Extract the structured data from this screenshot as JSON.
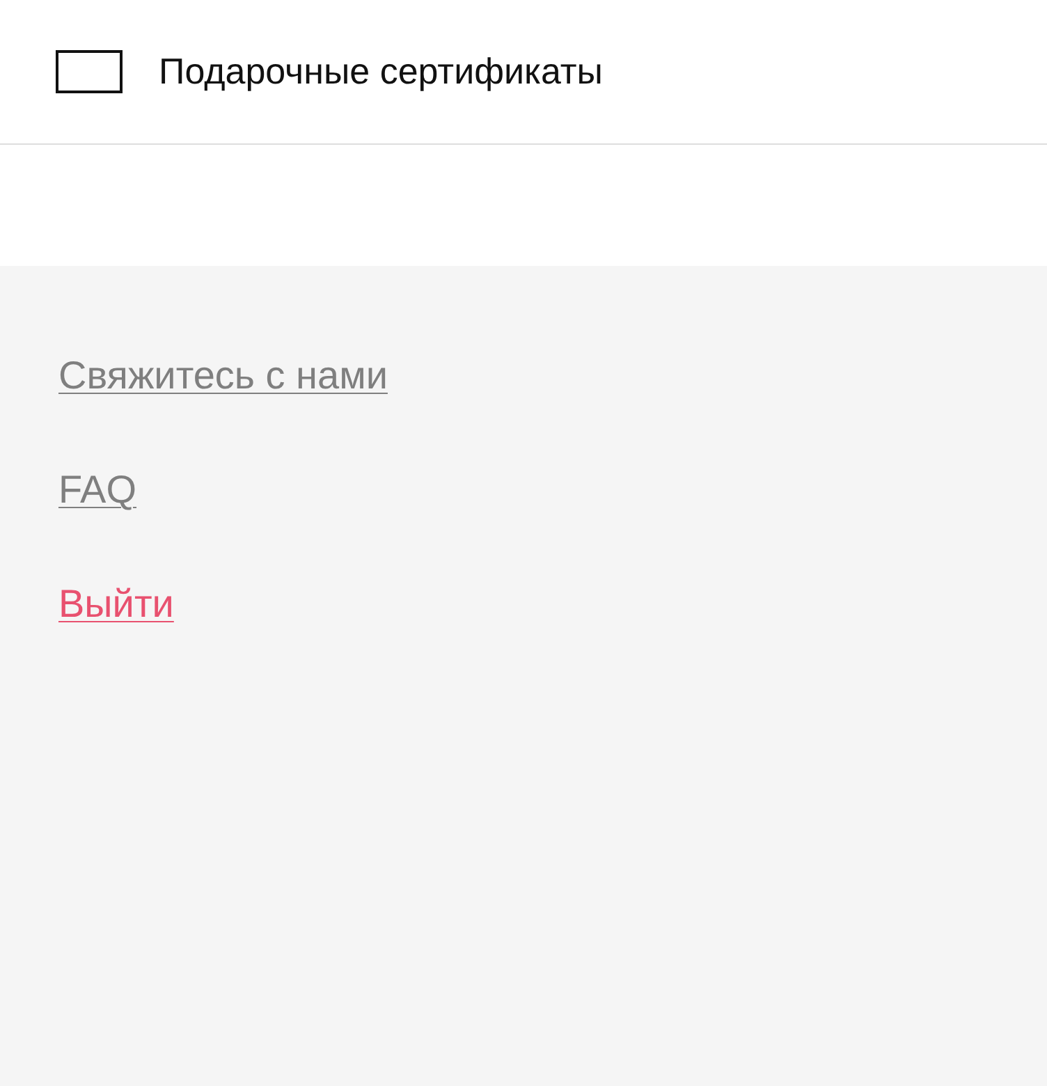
{
  "menu_item": {
    "label": "Подарочные сертификаты"
  },
  "footer_links": [
    {
      "label": "Свяжитесь с нами",
      "kind": "default"
    },
    {
      "label": "FAQ",
      "kind": "default"
    },
    {
      "label": "Выйти",
      "kind": "danger"
    }
  ]
}
